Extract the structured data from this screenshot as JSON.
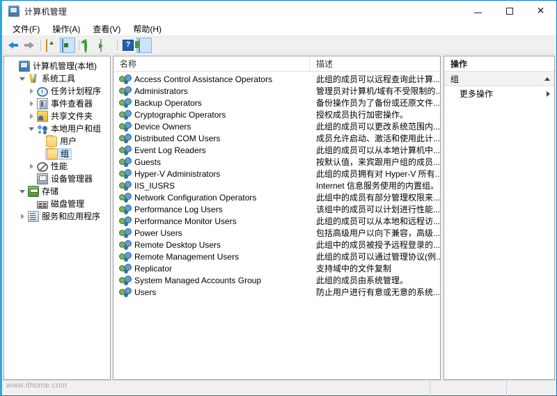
{
  "window": {
    "title": "计算机管理",
    "title_icon": "computer-management-icon",
    "minimize_label": "–",
    "maximize_label": "☐",
    "close_label": "✕"
  },
  "menubar": [
    {
      "label": "文件(F)",
      "name": "menu-file"
    },
    {
      "label": "操作(A)",
      "name": "menu-action"
    },
    {
      "label": "查看(V)",
      "name": "menu-view"
    },
    {
      "label": "帮助(H)",
      "name": "menu-help"
    }
  ],
  "toolbar": [
    {
      "name": "back-button",
      "icon": "arrow-left-icon",
      "active": false
    },
    {
      "name": "forward-button",
      "icon": "arrow-right-icon",
      "active": false
    },
    {
      "name": "separator-1",
      "icon": "separator",
      "active": false
    },
    {
      "name": "up-one-level-button",
      "icon": "folder-up-icon",
      "active": false
    },
    {
      "name": "properties-button",
      "icon": "properties-icon",
      "active": true
    },
    {
      "name": "separator-2",
      "icon": "separator",
      "active": false
    },
    {
      "name": "refresh-button",
      "icon": "refresh-icon",
      "active": false
    },
    {
      "name": "export-list-button",
      "icon": "export-icon",
      "active": false
    },
    {
      "name": "separator-3",
      "icon": "separator",
      "active": false
    },
    {
      "name": "help-button",
      "icon": "help-icon",
      "active": false,
      "glyph": "?"
    },
    {
      "name": "show-hide-action-pane-button",
      "icon": "show-action-pane-icon",
      "active": true
    }
  ],
  "tree": {
    "root": {
      "label": "计算机管理(本地)",
      "icon": "computer-icon",
      "indent": 0,
      "twisty": "none",
      "selected": false
    },
    "items": [
      {
        "label": "系统工具",
        "icon": "tools-icon",
        "indent": 1,
        "twisty": "expanded",
        "selected": false
      },
      {
        "label": "任务计划程序",
        "icon": "clock-icon",
        "indent": 2,
        "twisty": "collapsed",
        "selected": false
      },
      {
        "label": "事件查看器",
        "icon": "event-log-icon",
        "indent": 2,
        "twisty": "collapsed",
        "selected": false
      },
      {
        "label": "共享文件夹",
        "icon": "shared-folder-icon",
        "indent": 2,
        "twisty": "collapsed",
        "selected": false
      },
      {
        "label": "本地用户和组",
        "icon": "users-icon",
        "indent": 2,
        "twisty": "expanded",
        "selected": false
      },
      {
        "label": "用户",
        "icon": "folder-icon",
        "indent": 3,
        "twisty": "none",
        "selected": false
      },
      {
        "label": "组",
        "icon": "folder-icon",
        "indent": 3,
        "twisty": "none",
        "selected": true
      },
      {
        "label": "性能",
        "icon": "performance-icon",
        "indent": 2,
        "twisty": "collapsed",
        "selected": false
      },
      {
        "label": "设备管理器",
        "icon": "device-manager-icon",
        "indent": 2,
        "twisty": "none",
        "selected": false
      },
      {
        "label": "存储",
        "icon": "storage-icon",
        "indent": 1,
        "twisty": "expanded",
        "selected": false
      },
      {
        "label": "磁盘管理",
        "icon": "disk-icon",
        "indent": 2,
        "twisty": "none",
        "selected": false
      },
      {
        "label": "服务和应用程序",
        "icon": "services-icon",
        "indent": 1,
        "twisty": "collapsed",
        "selected": false
      }
    ]
  },
  "list": {
    "columns": [
      {
        "label": "名称",
        "name": "column-header-name"
      },
      {
        "label": "描述",
        "name": "column-header-description"
      }
    ],
    "rows": [
      {
        "name": "Access Control Assistance Operators",
        "description": "此组的成员可以远程查询此计算..."
      },
      {
        "name": "Administrators",
        "description": "管理员对计算机/域有不受限制的..."
      },
      {
        "name": "Backup Operators",
        "description": "备份操作员为了备份或还原文件..."
      },
      {
        "name": "Cryptographic Operators",
        "description": "授权成员执行加密操作。"
      },
      {
        "name": "Device Owners",
        "description": "此组的成员可以更改系统范围内..."
      },
      {
        "name": "Distributed COM Users",
        "description": "成员允许启动、激活和使用此计..."
      },
      {
        "name": "Event Log Readers",
        "description": "此组的成员可以从本地计算机中..."
      },
      {
        "name": "Guests",
        "description": "按默认值，来宾跟用户组的成员..."
      },
      {
        "name": "Hyper-V Administrators",
        "description": "此组的成员拥有对 Hyper-V 所有..."
      },
      {
        "name": "IIS_IUSRS",
        "description": "Internet 信息服务使用的内置组。"
      },
      {
        "name": "Network Configuration Operators",
        "description": "此组中的成员有部分管理权限来..."
      },
      {
        "name": "Performance Log Users",
        "description": "该组中的成员可以计划进行性能..."
      },
      {
        "name": "Performance Monitor Users",
        "description": "此组的成员可以从本地和远程访..."
      },
      {
        "name": "Power Users",
        "description": "包括高级用户以向下兼容，高级..."
      },
      {
        "name": "Remote Desktop Users",
        "description": "此组中的成员被授予远程登录的..."
      },
      {
        "name": "Remote Management Users",
        "description": "此组的成员可以通过管理协议(例..."
      },
      {
        "name": "Replicator",
        "description": "支持域中的文件复制"
      },
      {
        "name": "System Managed Accounts Group",
        "description": "此组的成员由系统管理。"
      },
      {
        "name": "Users",
        "description": "防止用户进行有意或无意的系统..."
      }
    ]
  },
  "actions": {
    "header": "操作",
    "group_label": "组",
    "items": [
      {
        "label": "更多操作",
        "name": "action-more-actions",
        "has_submenu": true
      }
    ]
  },
  "statusbar": {
    "watermark": "www.ithome.com"
  }
}
